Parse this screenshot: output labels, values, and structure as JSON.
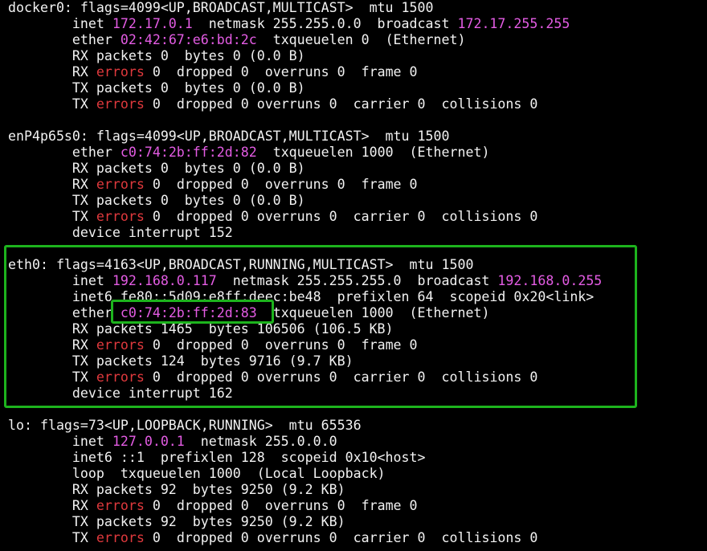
{
  "colors": {
    "background": "#000000",
    "text": "#f2f2f2",
    "address": "#e45ce4",
    "errors": "#e0393d",
    "highlight": "#1db31d"
  },
  "highlights": [
    "eth0-interface-block",
    "eth0-mac-address"
  ],
  "interfaces": [
    {
      "id": "docker0",
      "lines": [
        [
          {
            "t": "docker0: flags=4099<UP,BROADCAST,MULTICAST>  mtu 1500"
          }
        ],
        [
          {
            "t": "        inet "
          },
          {
            "t": "172.17.0.1",
            "c": "mag"
          },
          {
            "t": "  netmask 255.255.0.0  broadcast "
          },
          {
            "t": "172.17.255.255",
            "c": "mag"
          }
        ],
        [
          {
            "t": "        ether "
          },
          {
            "t": "02:42:67:e6:bd:2c",
            "c": "mag"
          },
          {
            "t": "  txqueuelen 0  (Ethernet)"
          }
        ],
        [
          {
            "t": "        RX packets 0  bytes 0 (0.0 B)"
          }
        ],
        [
          {
            "t": "        RX "
          },
          {
            "t": "errors",
            "c": "red"
          },
          {
            "t": " 0  dropped 0  overruns 0  frame 0"
          }
        ],
        [
          {
            "t": "        TX packets 0  bytes 0 (0.0 B)"
          }
        ],
        [
          {
            "t": "        TX "
          },
          {
            "t": "errors",
            "c": "red"
          },
          {
            "t": " 0  dropped 0 overruns 0  carrier 0  collisions 0"
          }
        ],
        [
          {
            "t": ""
          }
        ]
      ]
    },
    {
      "id": "enP4p65s0",
      "lines": [
        [
          {
            "t": "enP4p65s0: flags=4099<UP,BROADCAST,MULTICAST>  mtu 1500"
          }
        ],
        [
          {
            "t": "        ether "
          },
          {
            "t": "c0:74:2b:ff:2d:82",
            "c": "mag"
          },
          {
            "t": "  txqueuelen 1000  (Ethernet)"
          }
        ],
        [
          {
            "t": "        RX packets 0  bytes 0 (0.0 B)"
          }
        ],
        [
          {
            "t": "        RX "
          },
          {
            "t": "errors",
            "c": "red"
          },
          {
            "t": " 0  dropped 0  overruns 0  frame 0"
          }
        ],
        [
          {
            "t": "        TX packets 0  bytes 0 (0.0 B)"
          }
        ],
        [
          {
            "t": "        TX "
          },
          {
            "t": "errors",
            "c": "red"
          },
          {
            "t": " 0  dropped 0 overruns 0  carrier 0  collisions 0"
          }
        ],
        [
          {
            "t": "        device interrupt 152"
          }
        ],
        [
          {
            "t": ""
          }
        ]
      ]
    },
    {
      "id": "eth0",
      "lines": [
        [
          {
            "t": "eth0: flags=4163<UP,BROADCAST,RUNNING,MULTICAST>  mtu 1500"
          }
        ],
        [
          {
            "t": "        inet "
          },
          {
            "t": "192.168.0.117",
            "c": "mag"
          },
          {
            "t": "  netmask 255.255.255.0  broadcast "
          },
          {
            "t": "192.168.0.255",
            "c": "mag"
          }
        ],
        [
          {
            "t": "        inet6 fe80::5d09:e8ff:deec:be48  prefixlen 64  scopeid 0x20<link>"
          }
        ],
        [
          {
            "t": "        ether "
          },
          {
            "t": "c0:74:2b:ff:2d:83",
            "c": "mag"
          },
          {
            "t": "  txqueuelen 1000  (Ethernet)"
          }
        ],
        [
          {
            "t": "        RX packets 1465  bytes 106506 (106.5 KB)"
          }
        ],
        [
          {
            "t": "        RX "
          },
          {
            "t": "errors",
            "c": "red"
          },
          {
            "t": " 0  dropped 0  overruns 0  frame 0"
          }
        ],
        [
          {
            "t": "        TX packets 124  bytes 9716 (9.7 KB)"
          }
        ],
        [
          {
            "t": "        TX "
          },
          {
            "t": "errors",
            "c": "red"
          },
          {
            "t": " 0  dropped 0 overruns 0  carrier 0  collisions 0"
          }
        ],
        [
          {
            "t": "        device interrupt 162"
          }
        ],
        [
          {
            "t": ""
          }
        ]
      ]
    },
    {
      "id": "lo",
      "lines": [
        [
          {
            "t": "lo: flags=73<UP,LOOPBACK,RUNNING>  mtu 65536"
          }
        ],
        [
          {
            "t": "        inet "
          },
          {
            "t": "127.0.0.1",
            "c": "mag"
          },
          {
            "t": "  netmask 255.0.0.0"
          }
        ],
        [
          {
            "t": "        inet6 ::1  prefixlen 128  scopeid 0x10<host>"
          }
        ],
        [
          {
            "t": "        loop  txqueuelen 1000  (Local Loopback)"
          }
        ],
        [
          {
            "t": "        RX packets 92  bytes 9250 (9.2 KB)"
          }
        ],
        [
          {
            "t": "        RX "
          },
          {
            "t": "errors",
            "c": "red"
          },
          {
            "t": " 0  dropped 0  overruns 0  frame 0"
          }
        ],
        [
          {
            "t": "        TX packets 92  bytes 9250 (9.2 KB)"
          }
        ],
        [
          {
            "t": "        TX "
          },
          {
            "t": "errors",
            "c": "red"
          },
          {
            "t": " 0  dropped 0 overruns 0  carrier 0  collisions 0"
          }
        ]
      ]
    }
  ]
}
